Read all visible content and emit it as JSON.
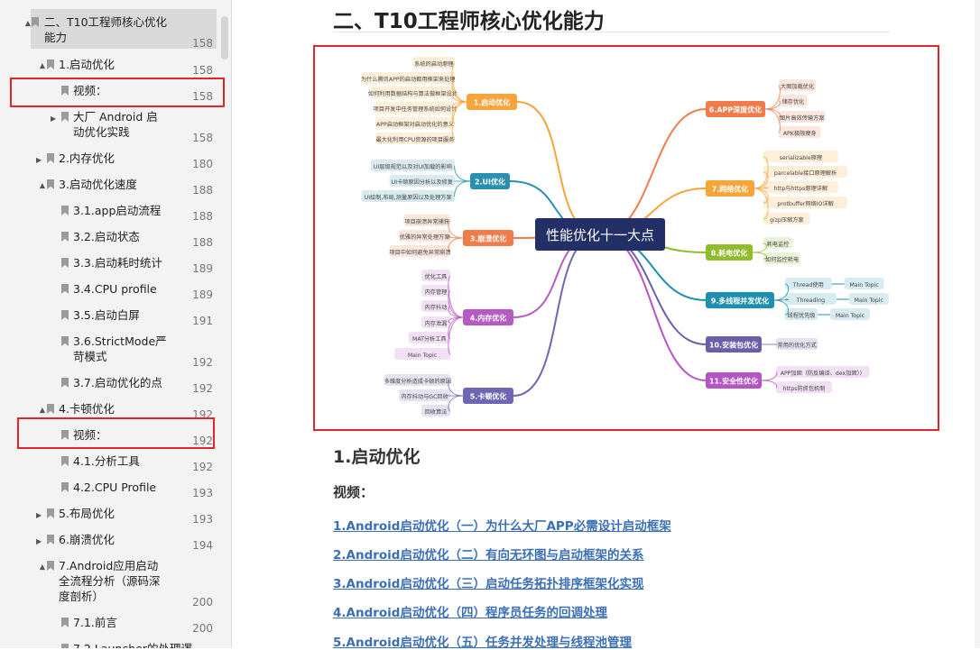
{
  "toc": {
    "items": [
      {
        "label": "二、T10工程师核心优化",
        "label2": "能力",
        "page": "158",
        "arrow": "▲",
        "selected": true
      },
      {
        "label": "1.启动优化",
        "page": "158",
        "arrow": "▲"
      },
      {
        "label": "视频：",
        "page": "158",
        "arrow": ""
      },
      {
        "label": "大厂 Android 启",
        "label2": "动优化实践",
        "page": "158",
        "arrow": "▶"
      },
      {
        "label": "2.内存优化",
        "page": "180",
        "arrow": "▶"
      },
      {
        "label": "3.启动优化速度",
        "page": "188",
        "arrow": "▲"
      },
      {
        "label": "3.1.app启动流程",
        "page": "188",
        "arrow": ""
      },
      {
        "label": "3.2.启动状态",
        "page": "188",
        "arrow": ""
      },
      {
        "label": "3.3.启动耗时统计",
        "page": "189",
        "arrow": ""
      },
      {
        "label": "3.4.CPU profile",
        "page": "189",
        "arrow": ""
      },
      {
        "label": "3.5.启动白屏",
        "page": "191",
        "arrow": ""
      },
      {
        "label": "3.6.StrictMode严",
        "label2": "苛模式",
        "page": "192",
        "arrow": ""
      },
      {
        "label": "3.7.启动优化的点",
        "page": "192",
        "arrow": ""
      },
      {
        "label": "4.卡顿优化",
        "page": "192",
        "arrow": "▲"
      },
      {
        "label": "视频：",
        "page": "192",
        "arrow": ""
      },
      {
        "label": "4.1.分析工具",
        "page": "192",
        "arrow": ""
      },
      {
        "label": "4.2.CPU Profile",
        "page": "193",
        "arrow": ""
      },
      {
        "label": "5.布局优化",
        "page": "193",
        "arrow": "▶"
      },
      {
        "label": "6.崩溃优化",
        "page": "194",
        "arrow": "▶"
      },
      {
        "label": "7.Android应用启动",
        "label2": "全流程分析（源码深",
        "label3": "度剖析）",
        "page": "200",
        "arrow": "▲"
      },
      {
        "label": "7.1.前言",
        "page": "200",
        "arrow": ""
      },
      {
        "label": "7.2.Launcher的处理逻",
        "page": "",
        "arrow": ""
      }
    ]
  },
  "doc": {
    "section_title": "二、T10工程师核心优化能力",
    "h_start": "1.启动优化",
    "h_video": "视频：",
    "links": [
      "1.Android启动优化（一）为什么大厂APP必需设计启动框架",
      "2.Android启动优化（二）有向无环图与启动框架的关系",
      "3.Android启动优化（三）启动任务拓扑排序框架化实现",
      "4.Android启动优化（四）程序员任务的回调处理",
      "5.Android启动优化（五）任务并发处理与线程池管理"
    ]
  },
  "mindmap": {
    "center": "性能优化十一大点",
    "branches": [
      {
        "label": "1.启动优化",
        "color": "#f7a43a",
        "leaves": [
          "系统的启动原理",
          "为什么腾讯APP的启动都用框架来处理",
          "如何利用数据结构与算法做框架设计",
          "项目开发中任务管理系统如何设计",
          "APP启动框架对启动优化的意义",
          "最大化利用CPU资源的项目服务"
        ]
      },
      {
        "label": "2.UI优化",
        "color": "#2a8fb0",
        "leaves": [
          "UI层级规范以及对UI加载的影响",
          "UI卡顿原因分析以及修复",
          "UI绘制,布局,测量原因以及处理方案"
        ]
      },
      {
        "label": "3.崩溃优化",
        "color": "#f07c4a",
        "leaves": [
          "项目崩溃异常捕获",
          "优雅的异常处理方案",
          "项目中如何避免异常崩溃"
        ]
      },
      {
        "label": "4.内存优化",
        "color": "#b55bc2",
        "leaves": [
          "优化工具",
          "内存管理",
          "内存抖动",
          "内存泄漏",
          "MAT分析工具",
          "Main Topic"
        ]
      },
      {
        "label": "5.卡顿优化",
        "color": "#7165b5",
        "leaves": [
          "多维度分析造成卡顿的原因",
          "内存抖动与GC回收",
          "回收算法"
        ]
      },
      {
        "label": "6.APP深度优化",
        "color": "#f07c4a",
        "leaves": [
          "大图加载优化",
          "储存优化",
          "图片高效传输方案",
          "APK极限瘦身"
        ]
      },
      {
        "label": "7.网络优化",
        "color": "#f7a43a",
        "leaves": [
          "serializable原理",
          "parcelable接口原理解析",
          "http与https原理详解",
          "protbuffer网络IO详解",
          "gizp压缩方案"
        ]
      },
      {
        "label": "8.耗电优化",
        "color": "#8fbc2b",
        "leaves": [
          "耗电监控",
          "如何监控耗电"
        ]
      },
      {
        "label": "9.多线程并发优化",
        "color": "#1f8fb0",
        "leaves": [
          "Thread使用",
          "Threading",
          "线程优先级"
        ],
        "sub": [
          "Main Topic",
          "Main Topic",
          "Main Topic"
        ]
      },
      {
        "label": "10.安装包优化",
        "color": "#6a5faa",
        "leaves": [
          "常用的优化方式"
        ]
      },
      {
        "label": "11.安全性优化",
        "color": "#b554c4",
        "leaves": [
          "APP加固（防反编译、dex加固））",
          "https防抓包机制"
        ]
      }
    ]
  }
}
